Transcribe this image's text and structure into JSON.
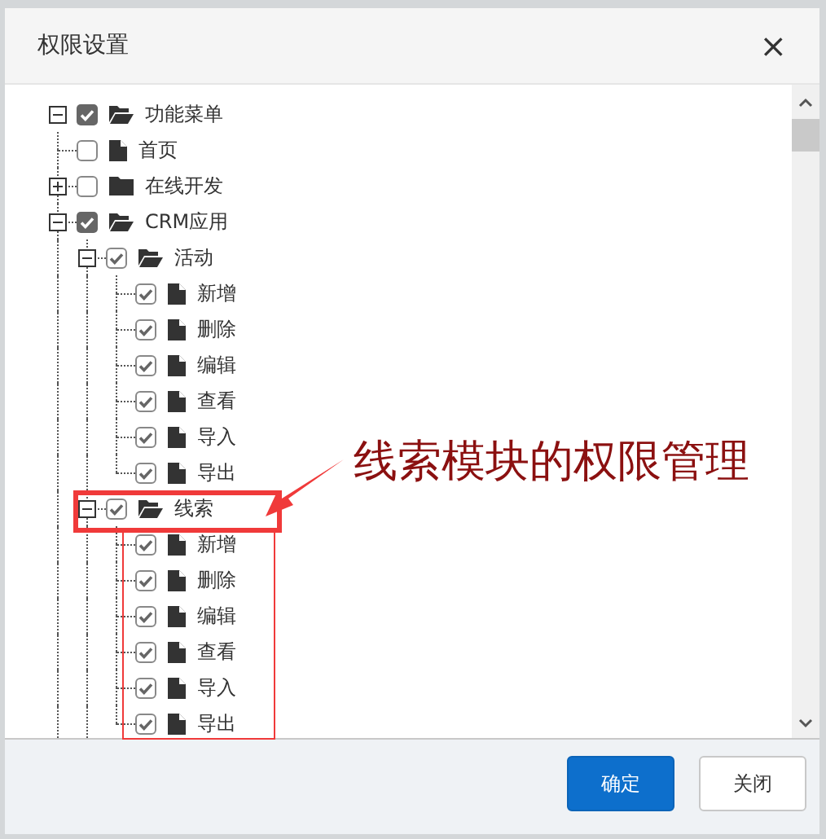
{
  "dialog": {
    "title": "权限设置",
    "close": "×"
  },
  "tree": [
    {
      "label": "功能菜单",
      "kind": "folder",
      "expanded": true,
      "checked": true,
      "partial": true,
      "children": [
        {
          "label": "首页",
          "kind": "file",
          "checked": false,
          "partial": false
        },
        {
          "label": "在线开发",
          "kind": "folder",
          "expanded": false,
          "checked": false,
          "partial": false
        },
        {
          "label": "CRM应用",
          "kind": "folder",
          "expanded": true,
          "checked": true,
          "partial": true,
          "children": [
            {
              "label": "活动",
              "kind": "folder",
              "expanded": true,
              "checked": true,
              "partial": false,
              "children": [
                {
                  "label": "新增",
                  "kind": "file",
                  "checked": true,
                  "partial": false
                },
                {
                  "label": "删除",
                  "kind": "file",
                  "checked": true,
                  "partial": false
                },
                {
                  "label": "编辑",
                  "kind": "file",
                  "checked": true,
                  "partial": false
                },
                {
                  "label": "查看",
                  "kind": "file",
                  "checked": true,
                  "partial": false
                },
                {
                  "label": "导入",
                  "kind": "file",
                  "checked": true,
                  "partial": false
                },
                {
                  "label": "导出",
                  "kind": "file",
                  "checked": true,
                  "partial": false
                }
              ]
            },
            {
              "label": "线索",
              "kind": "folder",
              "expanded": true,
              "checked": true,
              "partial": false,
              "children": [
                {
                  "label": "新增",
                  "kind": "file",
                  "checked": true,
                  "partial": false
                },
                {
                  "label": "删除",
                  "kind": "file",
                  "checked": true,
                  "partial": false
                },
                {
                  "label": "编辑",
                  "kind": "file",
                  "checked": true,
                  "partial": false
                },
                {
                  "label": "查看",
                  "kind": "file",
                  "checked": true,
                  "partial": false
                },
                {
                  "label": "导入",
                  "kind": "file",
                  "checked": true,
                  "partial": false
                },
                {
                  "label": "导出",
                  "kind": "file",
                  "checked": true,
                  "partial": false
                }
              ]
            }
          ]
        }
      ]
    }
  ],
  "annotation": {
    "text": "线索模块的权限管理"
  },
  "buttons": [
    {
      "label": "确定",
      "kind": "primary"
    },
    {
      "label": "关闭",
      "kind": "default"
    }
  ]
}
